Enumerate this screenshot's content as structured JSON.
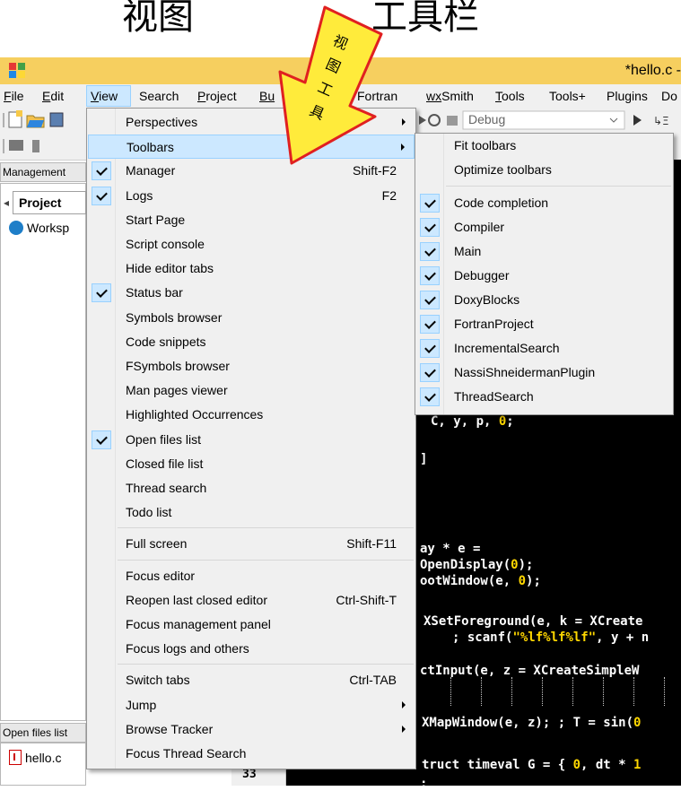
{
  "caption": {
    "left": "视图",
    "right": "工具栏"
  },
  "callout_text": [
    "视",
    "图",
    "工",
    "具"
  ],
  "window": {
    "title": "*hello.c -"
  },
  "menubar": [
    {
      "label": "File",
      "u": "F",
      "rest": "ile"
    },
    {
      "label": "Edit",
      "u": "E",
      "rest": "dit"
    },
    {
      "label": "View",
      "u": "V",
      "rest": "iew"
    },
    {
      "label": "Search",
      "u": "",
      "rest": "Search"
    },
    {
      "label": "Project",
      "u": "P",
      "rest": "roject"
    },
    {
      "label": "Bu",
      "u": "Bu",
      "rest": ""
    },
    {
      "label": "Fortran",
      "u": "",
      "rest": "Fortran"
    },
    {
      "label": "wxSmith",
      "u": "wx",
      "rest": "Smith"
    },
    {
      "label": "Tools",
      "u": "T",
      "rest": "ools"
    },
    {
      "label": "Tools+",
      "u": "",
      "rest": "Tools+"
    },
    {
      "label": "Plugins",
      "u": "",
      "rest": "Plugins"
    },
    {
      "label": "Do",
      "u": "",
      "rest": "Do"
    }
  ],
  "toolbar": {
    "build_target": "Debug"
  },
  "management": {
    "tab_label": "Management",
    "projects_tab": "Project",
    "workspace": "Worksp",
    "open_files_tab": "Open files list",
    "open_file": "hello.c"
  },
  "editor": {
    "line_number": "33",
    "code_lines": [
      ",",
      "C, y, p, 0;",
      "]",
      "ay * e =",
      "OpenDisplay(0);",
      "ootWindow(e, 0);",
      "XSetForeground(e, k = XCreate",
      "; scanf(\"%lf%lf%lf\", y + n",
      "ctInput(e, z = XCreateSimpleW",
      "XMapWindow(e, z); ; T = sin(0",
      "truct timeval G = { 0, dt * 1",
      ";"
    ]
  },
  "view_menu": [
    {
      "label": "Perspectives",
      "submenu": true
    },
    {
      "label": "Toolbars",
      "submenu": true,
      "highlighted": true
    },
    {
      "label": "Manager",
      "shortcut": "Shift-F2",
      "checked": true
    },
    {
      "label": "Logs",
      "shortcut": "F2",
      "checked": true
    },
    {
      "label": "Start Page"
    },
    {
      "label": "Script console"
    },
    {
      "label": "Hide editor tabs"
    },
    {
      "label": "Status bar",
      "checked": true
    },
    {
      "label": "Symbols browser"
    },
    {
      "label": "Code snippets"
    },
    {
      "label": "FSymbols browser"
    },
    {
      "label": "Man pages viewer"
    },
    {
      "label": "Highlighted Occurrences"
    },
    {
      "label": "Open files list",
      "checked": true
    },
    {
      "label": "Closed file list"
    },
    {
      "label": "Thread search"
    },
    {
      "label": "Todo list"
    },
    {
      "label": "Full screen",
      "shortcut": "Shift-F11"
    },
    {
      "label": "Focus editor"
    },
    {
      "label": "Reopen last closed editor",
      "shortcut": "Ctrl-Shift-T"
    },
    {
      "label": "Focus management panel"
    },
    {
      "label": "Focus logs and others"
    },
    {
      "label": "Switch tabs",
      "shortcut": "Ctrl-TAB"
    },
    {
      "label": "Jump",
      "submenu": true
    },
    {
      "label": "Browse Tracker",
      "submenu": true
    },
    {
      "label": "Focus Thread Search"
    }
  ],
  "toolbars_submenu": [
    {
      "label": "Fit toolbars"
    },
    {
      "label": "Optimize toolbars"
    },
    {
      "label": "Code completion",
      "checked": true
    },
    {
      "label": "Compiler",
      "checked": true
    },
    {
      "label": "Main",
      "checked": true
    },
    {
      "label": "Debugger",
      "checked": true
    },
    {
      "label": "DoxyBlocks",
      "checked": true
    },
    {
      "label": "FortranProject",
      "checked": true
    },
    {
      "label": "IncrementalSearch",
      "checked": true
    },
    {
      "label": "NassiShneidermanPlugin",
      "checked": true
    },
    {
      "label": "ThreadSearch",
      "checked": true
    }
  ],
  "colors": {
    "titlebar": "#f6cf5f",
    "menu_highlight": "#cce8ff",
    "editor_bg": "#000000",
    "callout": "#ffeb3b",
    "callout_border": "#e02020"
  }
}
